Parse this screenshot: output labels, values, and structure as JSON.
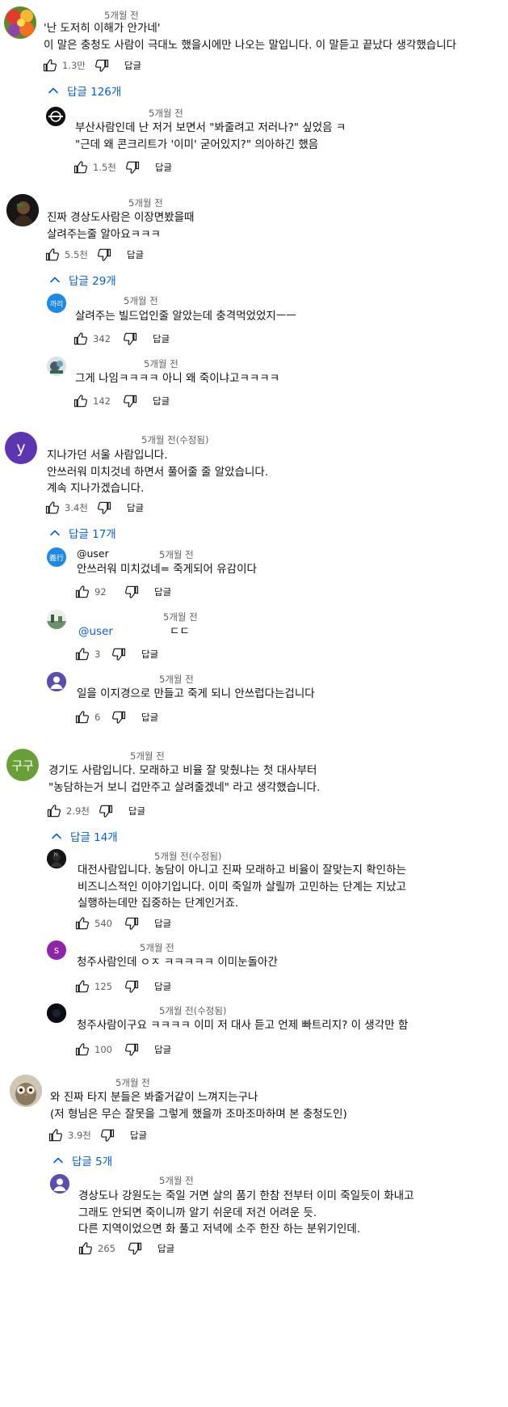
{
  "labels": {
    "reply": "답글"
  },
  "threads": [
    {
      "time": "5개월 전",
      "lines": [
        "'난 도저히 이해가 안가네'",
        "이 말은 충청도 사람이 극대노 했을시에만 나오는 말입니다. 이 말듣고 끝났다 생각했습니다"
      ],
      "likes": "1.3만",
      "replies_toggle": "답글 126개",
      "replies": [
        {
          "time": "5개월 전",
          "lines": [
            "부산사람인데 난 저거 보면서 \"봐줄려고 저러나?\" 싶었음 ㅋ",
            "\"근데 왜 콘크리트가 '이미' 굳어있지?\" 의아하긴 했음"
          ],
          "likes": "1.5천"
        }
      ]
    },
    {
      "time": "5개월 전",
      "lines": [
        "진짜 경상도사람은 이장면봤을때",
        "살려주는줄 알아요ㅋㅋㅋ"
      ],
      "likes": "5.5천",
      "replies_toggle": "답글 29개",
      "replies": [
        {
          "time": "5개월 전",
          "lines": [
            "살려주는 빌드업인줄 알았는데 충격먹었었지ㅡㅡ"
          ],
          "likes": "342"
        },
        {
          "time": "5개월 전",
          "lines": [
            "그게 나임ㅋㅋㅋㅋ 아니 왜 죽이냐고ㅋㅋㅋㅋ"
          ],
          "likes": "142"
        }
      ]
    },
    {
      "time": "5개월 전(수정됨)",
      "avatar_letter": "y",
      "lines": [
        "지나가던 서울 사람입니다.",
        "안쓰러워 미치것네 하면서 풀어줄 줄 알았습니다.",
        "계속 지나가겠습니다."
      ],
      "likes": "3.4천",
      "replies_toggle": "답글 17개",
      "replies": [
        {
          "time": "5개월 전",
          "avatar_text": "義行",
          "mention": "@user",
          "lines": [
            "안쓰러워 미치겄네= 죽게되어 유감이다"
          ],
          "likes": "92"
        },
        {
          "time": "5개월 전",
          "mention": "@user",
          "mention_tail": "ㄷㄷ",
          "lines": [],
          "likes": "3"
        },
        {
          "time": "5개월 전",
          "lines": [
            "일을 이지경으로 만들고 죽게 되니 안쓰럽다는겁니다"
          ],
          "likes": "6"
        }
      ]
    },
    {
      "time": "5개월 전",
      "avatar_letter": "구구",
      "lines": [
        "경기도 사람입니다. 모래하고 비율 잘 맞췄냐는 첫 대사부터",
        "\"농담하는거 보니 겁만주고 살려줄겠네\" 라고 생각했습니다."
      ],
      "likes": "2.9천",
      "replies_toggle": "답글 14개",
      "replies": [
        {
          "time": "5개월 전(수정됨)",
          "lines": [
            "대전사람입니다. 농담이 아니고 진짜 모래하고 비율이 잘맞는지 확인하는",
            "비즈니스적인 이야기입니다. 이미 죽일까 살릴까 고민하는 단계는 지났고",
            "실행하는데만 집중하는 단계인거죠."
          ],
          "likes": "540"
        },
        {
          "time": "5개월 전",
          "avatar_letter": "s",
          "lines": [
            "청주사람인데 ㅇㅈ ㅋㅋㅋㅋㅋ 이미눈돌아간"
          ],
          "likes": "125"
        },
        {
          "time": "5개월 전(수정됨)",
          "lines": [
            "청주사람이구요 ㅋㅋㅋㅋ 이미 저 대사 듣고 언제 빠트리지? 이 생각만 함"
          ],
          "likes": "100"
        }
      ]
    },
    {
      "time": "5개월 전",
      "lines": [
        "와 진짜 타지 분들은 봐줄거같이 느껴지는구나",
        "(저 형님은 무슨 잘못을 그렇게 했을까 조마조마하며 본 충청도인)"
      ],
      "likes": "3.9천",
      "replies_toggle": "답글 5개",
      "replies": [
        {
          "time": "5개월 전",
          "lines": [
            "경상도나 강원도는 죽일 거면 살의 품기 한참 전부터 이미 죽일듯이 화내고",
            "그래도 안되면 죽이니까 알기 쉬운데 저건 어려운 듯.",
            "다른 지역이었으면 화 풀고 저녁에 소주 한잔 하는 분위기인데."
          ],
          "likes": "265"
        }
      ]
    }
  ]
}
